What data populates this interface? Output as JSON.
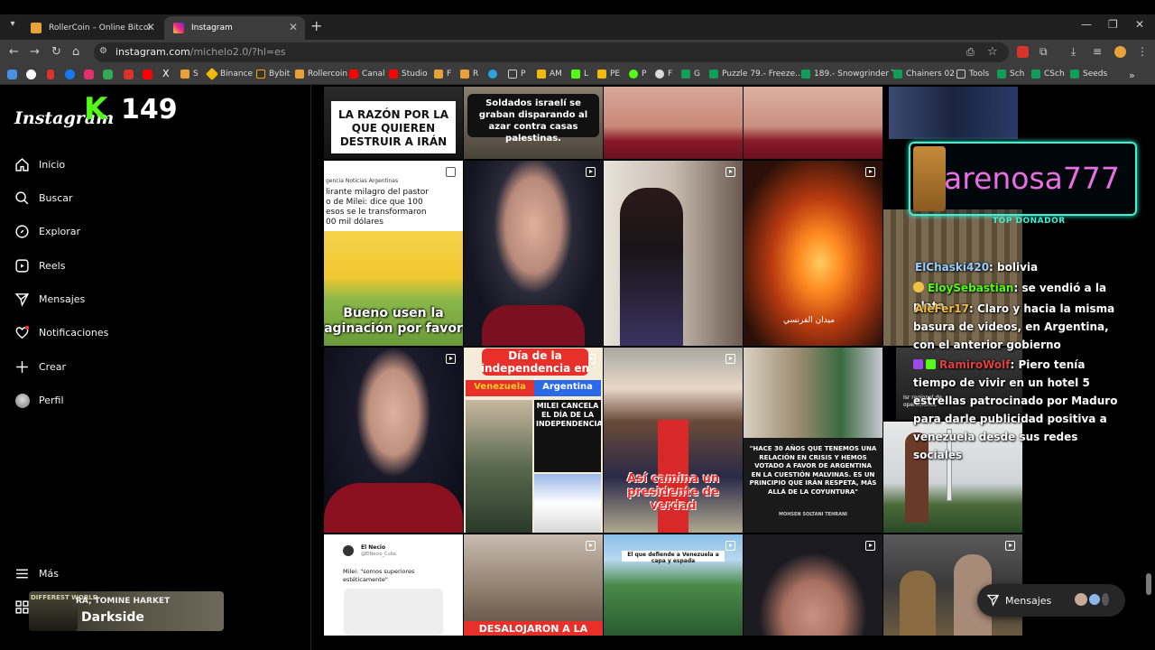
{
  "browser": {
    "tabs": [
      {
        "title": "RollerCoin – Online Bitcoin Min",
        "favicon_color": "#e8a23a"
      },
      {
        "title": "Instagram",
        "favicon_color": "#e1306c"
      }
    ],
    "url_host": "instagram.com",
    "url_path": "/michelo2.0/?hl=es",
    "bookmarks": [
      {
        "label": "S",
        "color": "#e8a23a"
      },
      {
        "label": "Binance",
        "color": "#f0b90b"
      },
      {
        "label": "Bybit",
        "color": "#f7a600"
      },
      {
        "label": "Rollercoin",
        "color": "#e8a23a"
      },
      {
        "label": "Canal",
        "color": "#ff0000"
      },
      {
        "label": "Studio",
        "color": "#ff0000"
      },
      {
        "label": "F",
        "color": "#e8a23a"
      },
      {
        "label": "R",
        "color": "#e8a23a"
      },
      {
        "label": "P",
        "color": "#888888"
      },
      {
        "label": "AM",
        "color": "#f0b90b"
      },
      {
        "label": "L",
        "color": "#53fc18"
      },
      {
        "label": "PE",
        "color": "#f0b90b"
      },
      {
        "label": "P",
        "color": "#53fc18"
      },
      {
        "label": "F",
        "color": "#dddddd"
      },
      {
        "label": "G",
        "color": "#0f9d58"
      },
      {
        "label": "Puzzle 79.- Freeze...",
        "color": "#0f9d58"
      },
      {
        "label": "189.- Snowgrinder T...",
        "color": "#0f9d58"
      },
      {
        "label": "Chainers 02",
        "color": "#0f9d58"
      },
      {
        "label": "Tools",
        "color": "#888888"
      },
      {
        "label": "Sch",
        "color": "#0f9d58"
      },
      {
        "label": "CSch",
        "color": "#0f9d58"
      },
      {
        "label": "Seeds",
        "color": "#0f9d58"
      }
    ]
  },
  "sidebar": {
    "logo": "Instagram",
    "kick_count": "149",
    "items": [
      {
        "label": "Inicio",
        "icon": "home-icon"
      },
      {
        "label": "Buscar",
        "icon": "search-icon"
      },
      {
        "label": "Explorar",
        "icon": "compass-icon"
      },
      {
        "label": "Reels",
        "icon": "reels-icon"
      },
      {
        "label": "Mensajes",
        "icon": "send-icon"
      },
      {
        "label": "Notificaciones",
        "icon": "heart-icon"
      },
      {
        "label": "Crear",
        "icon": "plus-icon"
      },
      {
        "label": "Perfil",
        "icon": "avatar-icon"
      }
    ],
    "more_label": "Más",
    "now_playing": {
      "artist": "RA, TOMINE HARKET",
      "title": "Darkside",
      "art_text": "DIFFEREST WORLD"
    }
  },
  "grid": {
    "captions": {
      "t1": "LA RAZÓN POR LA QUE QUIEREN DESTRUIR A IRÁN",
      "t2": "Soldados israelí se graban disparando al azar contra casas palestinas.",
      "t6_source": "gencia Noticias Argentinas",
      "t6_text": "lirante milagro del pastor o de Milei: dice que 100 esos se le transformaron 00 mil dólares",
      "t6_bottom": "Bueno usen la aginación por favor",
      "t9_watermark": "ميدان الفرنسي",
      "t12_title": "Día de la independencia en :",
      "t12_left": "Venezuela",
      "t12_right": "Argentina",
      "t12_headline": "MILEI CANCELA EL DÍA DE LA INDEPENDENCIA",
      "t13": "Así camina un presidente de verdad",
      "t14_quote": "\"HACE 30 AÑOS QUE TENEMOS UNA RELACIÓN EN CRISIS Y HEMOS VOTADO A FAVOR DE ARGENTINA EN LA CUESTIÓN MALVINAS. ES UN PRINCIPIO QUE IRÁN RESPETA, MÁS ALLÁ DE LA COYUNTURA\"",
      "t14_author": "MOHSEN SOLTANI TEHRANI",
      "t15_tag": "Isr regional de operaciones",
      "t16_user": "El Necio",
      "t16_handle": "@ElNecio_Cuba",
      "t16_text": "Milei: \"somos superiores estéticamente\"",
      "t17": "DESALOJARON A LA",
      "t18": "El que defiende a Venezuela a capa y espada"
    }
  },
  "overlay": {
    "donor_name": "arenosa777",
    "donor_label": "TOP DONADOR",
    "chat": [
      {
        "user": "ElChaski420",
        "user_color": "#9ad0ff",
        "text": ": bolivia"
      },
      {
        "user": "EloySebastian",
        "user_color": "#53fc18",
        "text": ": se vendió a la plata"
      },
      {
        "user": "AleFer17",
        "user_color": "#f0c040",
        "text": ": Claro y hacia la misma basura de videos, en Argentina, con el anterior gobierno"
      },
      {
        "user": "RamiroWolf",
        "user_color": "#e04040",
        "text": ": Piero tenía tiempo de vivir en un hotel 5 estrellas patrocinado por Maduro para darle publicidad positiva a venezuela desde sus redes sociales"
      }
    ]
  },
  "messages_bar": {
    "label": "Mensajes"
  }
}
